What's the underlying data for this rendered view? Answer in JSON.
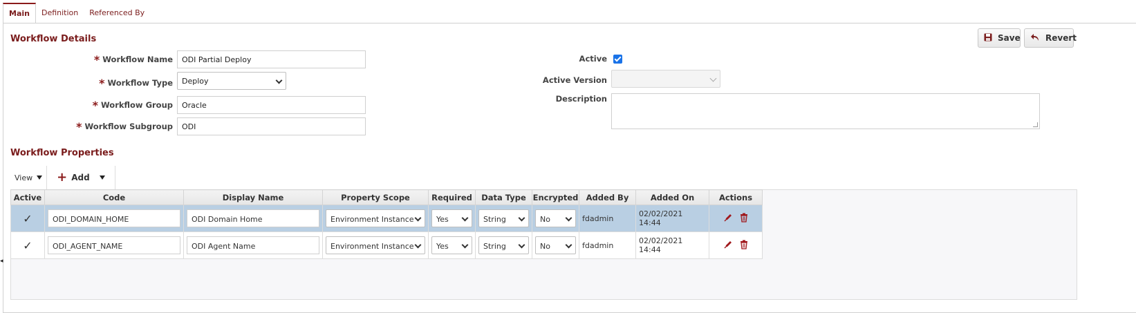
{
  "tabs": [
    {
      "label": "Main",
      "active": true
    },
    {
      "label": "Definition",
      "active": false
    },
    {
      "label": "Referenced By",
      "active": false
    }
  ],
  "workflow_details": {
    "title": "Workflow Details",
    "name_label": "Workflow Name",
    "name_value": "ODI Partial Deploy",
    "type_label": "Workflow Type",
    "type_value": "Deploy",
    "group_label": "Workflow Group",
    "group_value": "Oracle",
    "subgroup_label": "Workflow Subgroup",
    "subgroup_value": "ODI",
    "active_label": "Active",
    "active_checked": true,
    "active_version_label": "Active Version",
    "active_version_value": "",
    "description_label": "Description",
    "description_value": ""
  },
  "buttons": {
    "save": "Save",
    "revert": "Revert"
  },
  "properties": {
    "title": "Workflow Properties",
    "toolbar": {
      "view": "View",
      "add": "Add"
    },
    "columns": [
      "Active",
      "Code",
      "Display Name",
      "Property Scope",
      "Required",
      "Data Type",
      "Encrypted",
      "Added By",
      "Added On",
      "Actions"
    ],
    "rows": [
      {
        "active": "✓",
        "code": "ODI_DOMAIN_HOME",
        "display_name": "ODI Domain Home",
        "scope": "Environment Instance",
        "required": "Yes",
        "data_type": "String",
        "encrypted": "No",
        "added_by": "fdadmin",
        "added_on": "02/02/2021 14:44"
      },
      {
        "active": "✓",
        "code": "ODI_AGENT_NAME",
        "display_name": "ODI Agent Name",
        "scope": "Environment Instance",
        "required": "Yes",
        "data_type": "String",
        "encrypted": "No",
        "added_by": "fdadmin",
        "added_on": "02/02/2021 14:44"
      }
    ]
  },
  "colors": {
    "accent": "#7a1c1c",
    "selected_row": "#b9cfe3",
    "checkbox": "#1a73e8"
  }
}
